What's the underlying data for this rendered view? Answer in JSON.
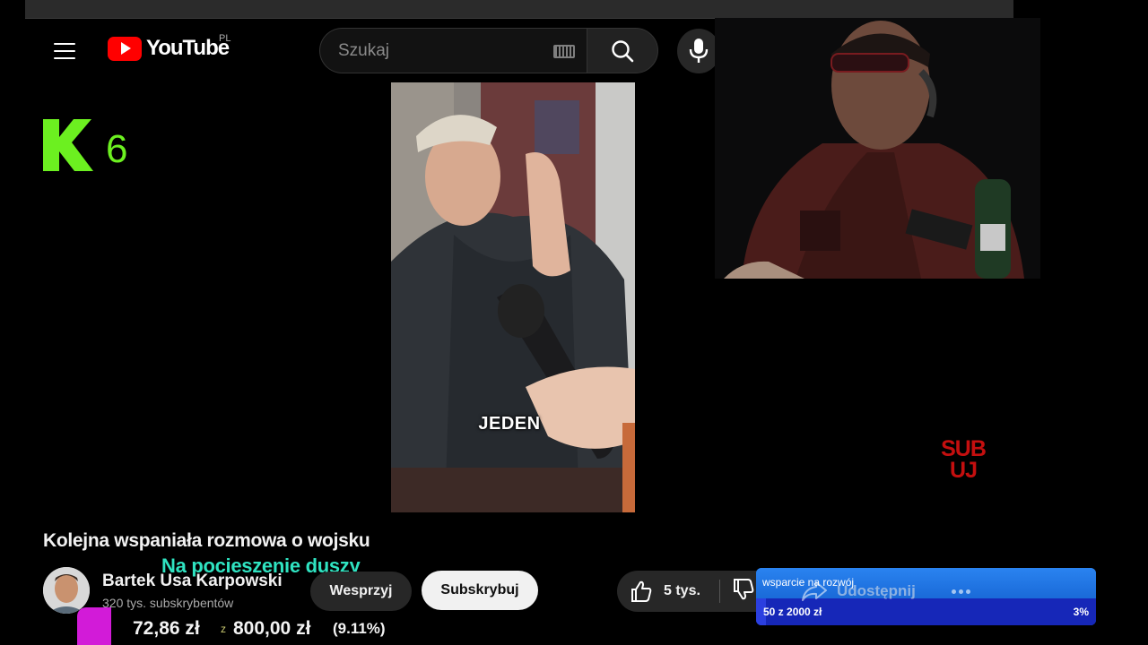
{
  "header": {
    "logo_text": "YouTube",
    "country_code": "PL",
    "search_placeholder": "Szukaj"
  },
  "channel_badge": {
    "number": "6"
  },
  "video": {
    "caption": "JEDEN",
    "title": "Kolejna wspaniała rozmowa o wojsku"
  },
  "overlay": {
    "text": "Na pocieszenie duszy",
    "sub_label_line1": "SUB",
    "sub_label_line2": "UJ"
  },
  "channel": {
    "name": "Bartek Usa Karpowski",
    "subscribers": "320 tys. subskrybentów"
  },
  "actions": {
    "support_label": "Wesprzyj",
    "subscribe_label": "Subskrybuj",
    "like_count": "5 tys.",
    "share_label": "Udostępnij"
  },
  "donation_goal": {
    "label": "wsparcie na rozwój",
    "amount_text": "50 z 2000 zł",
    "percent_text": "3%",
    "progress": 0.03,
    "color_top": "#2a83f0",
    "color_bar": "#1627b8"
  },
  "tip_counter": {
    "current": "72,86 zł",
    "separator": "z",
    "target": "800,00 zł",
    "percent": "(9.11%)",
    "accent": "#d21bd8"
  },
  "colors": {
    "youtube_red": "#ff0000",
    "k6_green": "#6cf020",
    "overlay_teal": "#2fe3c1",
    "sub_red": "#c40f0f"
  }
}
